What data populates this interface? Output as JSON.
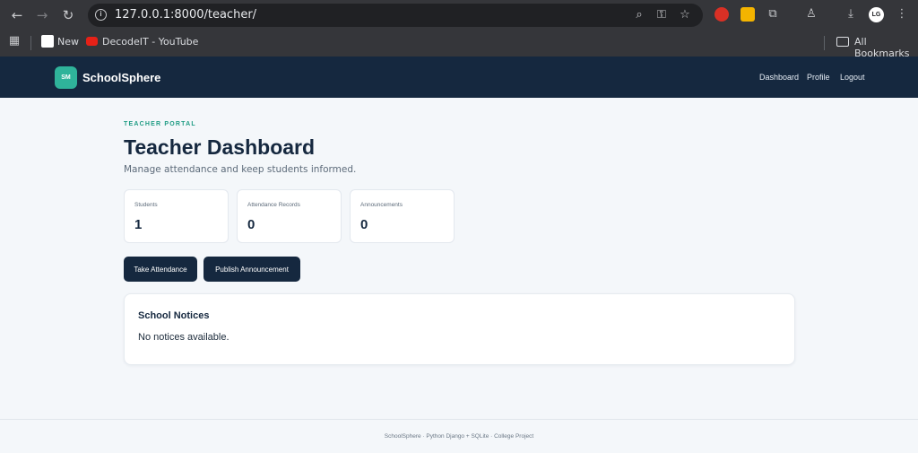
{
  "browser": {
    "url": "127.0.0.1:8000/teacher/",
    "bookmarks": [
      {
        "label": "New"
      },
      {
        "label": "DecodeIT - YouTube"
      }
    ],
    "all_bookmarks": "All Bookmarks",
    "profile_initials": "LG"
  },
  "app": {
    "logo": "SM",
    "brand": "SchoolSphere",
    "nav": [
      "Dashboard",
      "Profile",
      "Logout"
    ]
  },
  "page": {
    "eyebrow": "TEACHER PORTAL",
    "title": "Teacher Dashboard",
    "subtitle": "Manage attendance and keep students informed."
  },
  "stats": [
    {
      "label": "Students",
      "value": "1"
    },
    {
      "label": "Attendance Records",
      "value": "0"
    },
    {
      "label": "Announcements",
      "value": "0"
    }
  ],
  "actions": {
    "take_attendance": "Take Attendance",
    "publish_announcement": "Publish Announcement"
  },
  "notices": {
    "title": "School Notices",
    "empty": "No notices available."
  },
  "footer": "SchoolSphere · Python Django + SQLite · College Project",
  "colors": {
    "header_bg": "#15283f",
    "accent": "#2fb39a",
    "button_bg": "#15283f",
    "page_bg": "#f4f7fa"
  }
}
